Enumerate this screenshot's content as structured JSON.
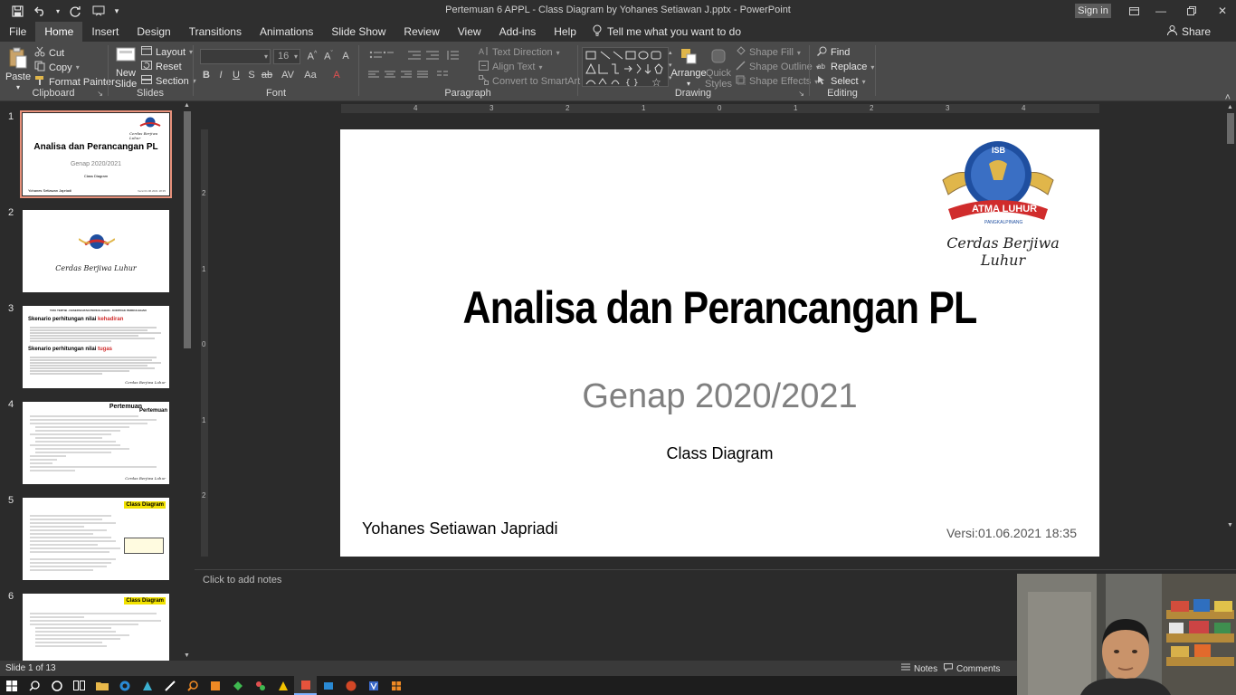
{
  "window": {
    "title": "Pertemuan 6 APPL - Class Diagram by Yohanes Setiawan J.pptx - PowerPoint",
    "signin": "Sign in"
  },
  "tabs": [
    "File",
    "Home",
    "Insert",
    "Design",
    "Transitions",
    "Animations",
    "Slide Show",
    "Review",
    "View",
    "Add-ins",
    "Help"
  ],
  "tell_me": "Tell me what you want to do",
  "share": "Share",
  "ribbon": {
    "clipboard": {
      "label": "Clipboard",
      "paste": "Paste",
      "cut": "Cut",
      "copy": "Copy",
      "format_painter": "Format Painter"
    },
    "slides": {
      "label": "Slides",
      "new_slide_1": "New",
      "new_slide_2": "Slide",
      "layout": "Layout",
      "reset": "Reset",
      "section": "Section"
    },
    "font": {
      "label": "Font",
      "size": "16"
    },
    "paragraph": {
      "label": "Paragraph",
      "text_direction": "Text Direction",
      "align_text": "Align Text",
      "convert": "Convert to SmartArt"
    },
    "drawing": {
      "label": "Drawing",
      "arrange": "Arrange",
      "quick_1": "Quick",
      "quick_2": "Styles",
      "shape_fill": "Shape Fill",
      "shape_outline": "Shape Outline",
      "shape_effects": "Shape Effects"
    },
    "editing": {
      "label": "Editing",
      "find": "Find",
      "replace": "Replace",
      "select": "Select"
    }
  },
  "ruler": {
    "h_ticks": [
      "4",
      "3",
      "2",
      "1",
      "0",
      "1",
      "2",
      "3",
      "4"
    ],
    "v_ticks": [
      "2",
      "1",
      "0",
      "1",
      "2"
    ]
  },
  "thumbnails": [
    {
      "num": "1",
      "title": "Analisa dan Perancangan PL",
      "sub": "Genap 2020/2021",
      "sub2": "Class Diagram",
      "author": "Yohanes Setiawan Japriadi",
      "ver": "Versi:01.06.2021 18:35",
      "tag": "Cerdas Berjiwa Luhur"
    },
    {
      "num": "2",
      "tag": "Cerdas Berjiwa Luhur"
    },
    {
      "num": "3",
      "head": "TATA TERTIB - KESEPAKATAN PERKULIAHAN - KONTRAK PERKULIAHAN",
      "h1": "Skenario perhitungan nilai ",
      "h1b": "kehadiran",
      "h2": "Skenario perhitungan nilai ",
      "h2b": "tugas",
      "tag": "Cerdas Berjiwa Luhur"
    },
    {
      "num": "4",
      "head": "Pertemuan",
      "head2": "Pertemuan",
      "tag": "Cerdas Berjiwa Luhur"
    },
    {
      "num": "5",
      "badge": "Class Diagram"
    },
    {
      "num": "6",
      "badge": "Class Diagram"
    }
  ],
  "slide": {
    "tag": "Cerdas Berjiwa Luhur",
    "logo_top": "ISB",
    "logo_ribbon": "ATMA LUHUR",
    "logo_sub": "PANGKALPINANG",
    "title": "Analisa dan Perancangan PL",
    "subtitle": "Genap 2020/2021",
    "subtitle2": "Class Diagram",
    "author": "Yohanes Setiawan Japriadi",
    "version": "Versi:01.06.2021 18:35"
  },
  "notes_placeholder": "Click to add notes",
  "status": {
    "slide_count": "Slide 1 of 13",
    "notes": "Notes",
    "comments": "Comments"
  },
  "colors": {
    "accent": "#d24726",
    "thumb_selected": "#e8927c",
    "ribbon_bg": "#4a4a4a"
  }
}
